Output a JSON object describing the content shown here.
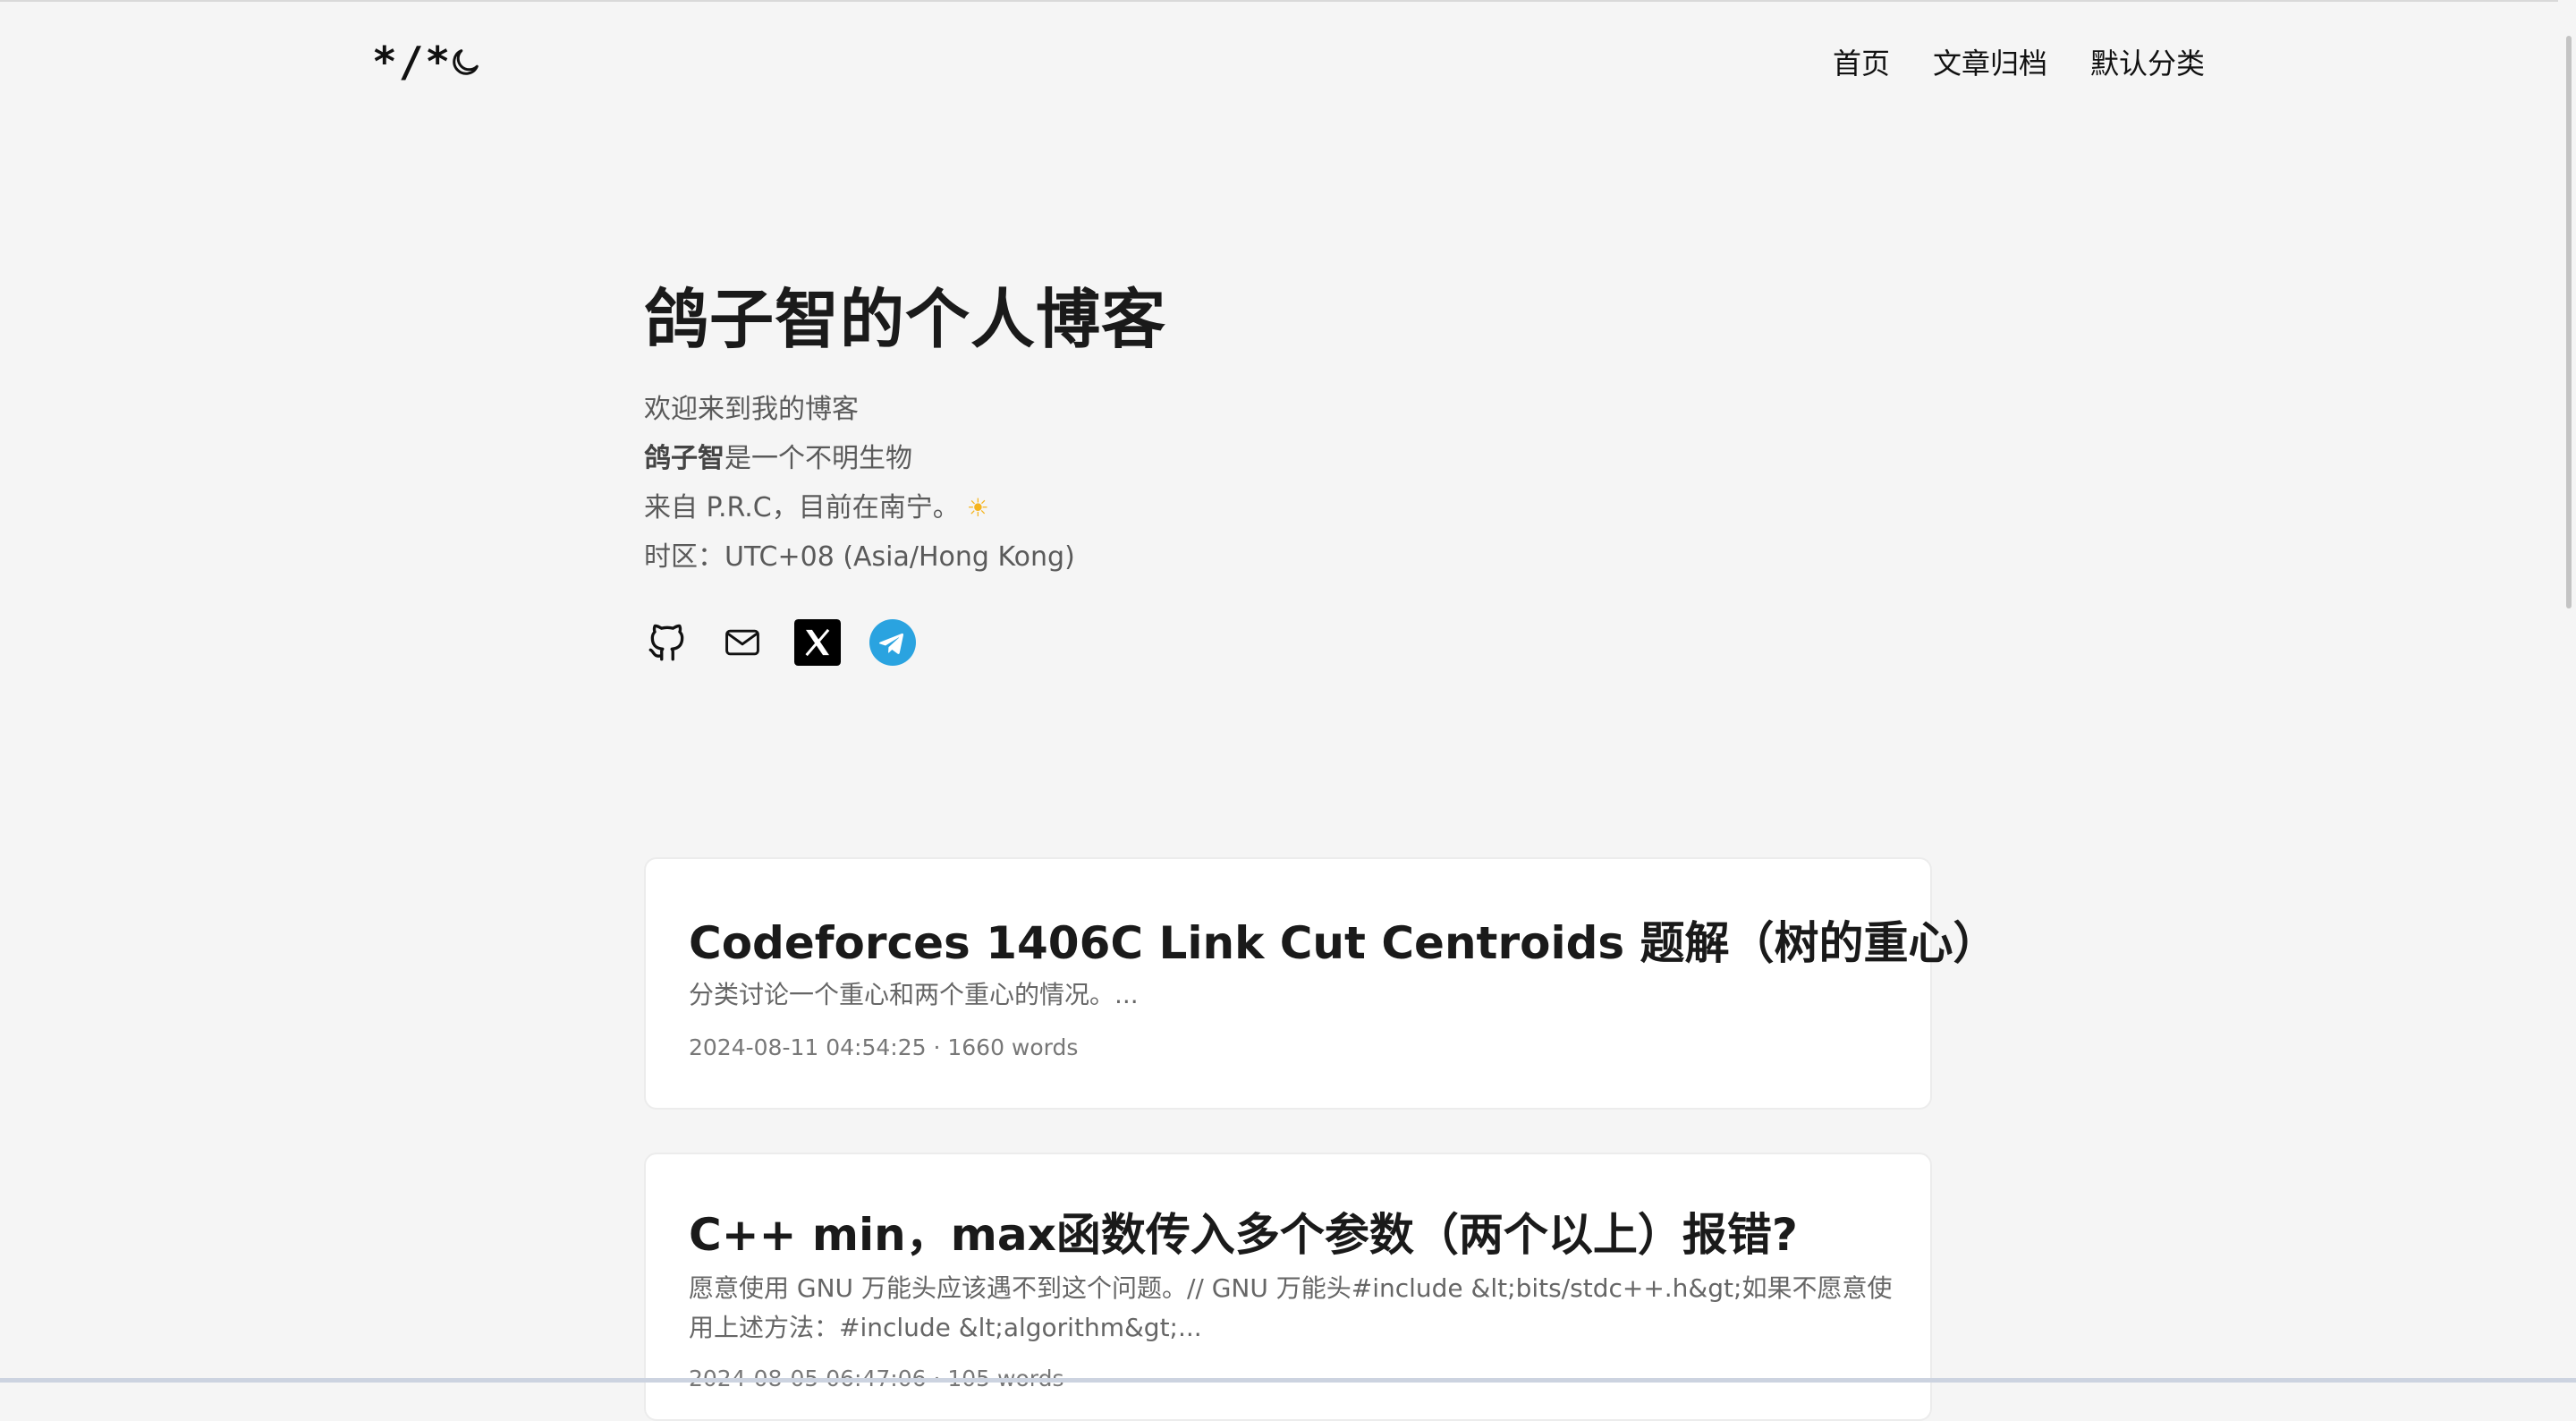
{
  "header": {
    "logo": "*/*",
    "nav": [
      "首页",
      "文章归档",
      "默认分类"
    ]
  },
  "profile": {
    "title": "鸽子智的个人博客",
    "welcome": "欢迎来到我的博客",
    "name_bold": "鸽子智",
    "name_rest": "是一个不明生物",
    "location": "来自 P.R.C，目前在南宁。",
    "timezone": "时区：UTC+08 (Asia/Hong Kong)"
  },
  "socials": [
    {
      "icon": "github-icon"
    },
    {
      "icon": "mail-icon"
    },
    {
      "icon": "x-icon"
    },
    {
      "icon": "telegram-icon"
    }
  ],
  "posts": [
    {
      "title": "Codeforces 1406C Link Cut Centroids 题解（树的重心）",
      "excerpt": "分类讨论一个重心和两个重心的情况。...",
      "meta": "2024-08-11 04:54:25 · 1660 words"
    },
    {
      "title": "C++ min，max函数传入多个参数（两个以上）报错?",
      "excerpt": "愿意使用 GNU 万能头应该遇不到这个问题。// GNU 万能头#include &lt;bits/stdc++.h&gt;如果不愿意使用上述方法：#include &lt;algorithm&gt;...",
      "meta": "2024-08-05 06:47:06 · 105 words"
    }
  ],
  "colors": {
    "background": "#f5f5f5",
    "card": "#ffffff",
    "sun": "#f5b41e",
    "telegram": "#2aa3e0"
  }
}
